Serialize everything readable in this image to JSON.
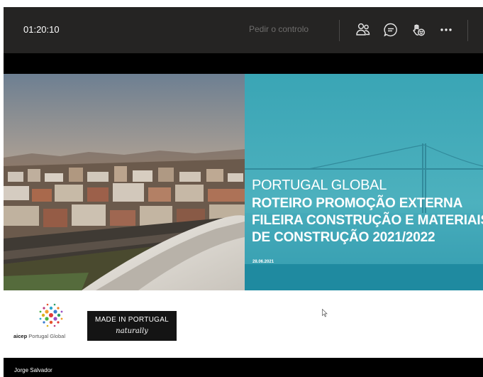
{
  "meeting_bar": {
    "timer": "01:20:10",
    "request_control_label": "Pedir o controlo",
    "icons": [
      "participants-icon",
      "chat-icon",
      "reactions-icon",
      "more-options-icon"
    ]
  },
  "slide": {
    "brand": "PORTUGAL GLOBAL",
    "title_lines": [
      "ROTEIRO PROMOÇÃO EXTERNA",
      "FILEIRA CONSTRUÇÃO E MATERIAIS",
      "DE CONSTRUÇÃO 2021/2022"
    ],
    "date": "28.06.2021",
    "logos": {
      "aicep_prefix": "aicep",
      "aicep_suffix": "Portugal Global",
      "made_in_portugal_line1": "MADE IN PORTUGAL",
      "made_in_portugal_line2": "naturally"
    },
    "colors": {
      "teal_panel": "#2f9db0",
      "teal_band": "#1f8aa0",
      "badge_bg": "#141414"
    }
  },
  "presenter": {
    "name": "Jorge Salvador"
  }
}
